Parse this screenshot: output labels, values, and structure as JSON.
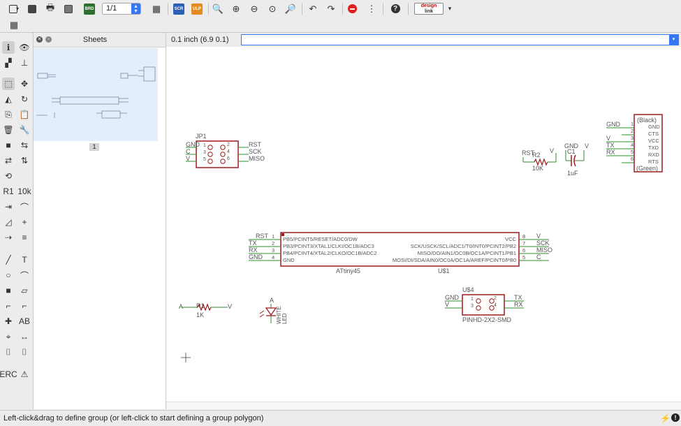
{
  "toolbar": {
    "page_value": "1/1",
    "icons": [
      "open-icon",
      "save-icon",
      "print-icon",
      "cam-icon",
      "board-icon",
      "page-select",
      "sheet-icon",
      "scr-icon",
      "ulp-icon",
      "zoom-fit-icon",
      "zoom-in-icon",
      "zoom-out-icon",
      "zoom-redraw-icon",
      "zoom-select-icon",
      "undo-icon",
      "redo-icon",
      "stop-icon",
      "go-icon",
      "help-icon",
      "design-link-icon"
    ],
    "scr_label": "SCR",
    "ulp_label": "ULP",
    "brd_label": "BRD",
    "design_link_line1": "design",
    "design_link_line2": "link"
  },
  "sheets": {
    "title": "Sheets",
    "page_number": "1"
  },
  "coordbar": {
    "coordinates": "0.1 inch (6.9 0.1)",
    "command_value": ""
  },
  "status": {
    "message": "Left-click&drag to define group (or left-click to start defining a group polygon)"
  },
  "schematic": {
    "jp1": {
      "name": "JP1",
      "left": [
        "GND",
        "C",
        "V"
      ],
      "right": [
        "RST",
        "SCK",
        "MISO"
      ],
      "pins": [
        "1",
        "2",
        "3",
        "4",
        "5",
        "6"
      ]
    },
    "r2": {
      "name": "R2",
      "value": "10K",
      "left": "RST",
      "right": "V"
    },
    "c1": {
      "name": "C1",
      "value": "1uF",
      "left": "GND",
      "right": "V"
    },
    "ftdi": {
      "top": "(Black)",
      "bottom": "(Green)",
      "pins": [
        "GND",
        "CTS",
        "VCC",
        "TXD",
        "RXD",
        "RTS"
      ],
      "nums": [
        "1",
        "2",
        "3",
        "4",
        "5",
        "6"
      ],
      "nets": [
        "GND",
        "V",
        "TX",
        "RX"
      ]
    },
    "attiny": {
      "name": "ATtiny45",
      "ref": "U$1",
      "left_pins": [
        "PB5/PCINT5/RESET/ADC0/DW",
        "PB3/PCINT3/XTAL1/CLKI/OC1B/ADC3",
        "PB4/PCINT4/XTAL2/CLKO/OC1B/ADC2",
        "GND"
      ],
      "right_pins": [
        "VCC",
        "SCK/USCK/SCL/ADC1/T0/INT0/PCINT2/PB2",
        "MISO/DO/AIN1/OC0B/OC1A/PCINT1/PB1",
        "MOSI/DI/SDA/AIN0/OC0A/OC1A/AREF/PCINT0/PB0"
      ],
      "left_nums": [
        "1",
        "2",
        "3",
        "4"
      ],
      "right_nums": [
        "8",
        "7",
        "6",
        "5"
      ],
      "left_nets": [
        "RST",
        "TX",
        "RX",
        "GND"
      ],
      "right_nets": [
        "V",
        "SCK",
        "MISO",
        "C"
      ]
    },
    "r1": {
      "name": "R1",
      "value": "1K",
      "left": "A",
      "right": "V"
    },
    "led": {
      "ref": "A",
      "line1": "WHITE",
      "line2": "LED"
    },
    "us4": {
      "name": "U$4",
      "footprint": "PINHD-2X2-SMD",
      "left": [
        "GND",
        "V"
      ],
      "right": [
        "TX",
        "RX"
      ],
      "pins": [
        "1",
        "2",
        "3",
        "4"
      ]
    }
  },
  "colors": {
    "accent": "#3478f6",
    "part": "#9c1c1c",
    "wire": "#2e8b2e",
    "label": "#555555"
  }
}
